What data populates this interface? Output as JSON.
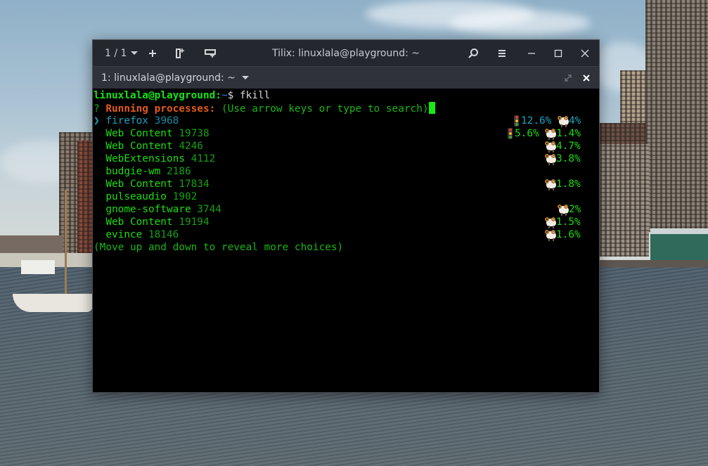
{
  "window": {
    "title": "Tilix: linuxlala@playground: ~",
    "session_counter": "1 / 1",
    "headerbar_icons": [
      "chevron-down-icon",
      "add-icon",
      "split-horizontal-icon",
      "split-vertical-icon",
      "search-icon",
      "hamburger-menu-icon",
      "minimize-icon",
      "maximize-icon",
      "close-icon"
    ]
  },
  "tab": {
    "label": "1: linuxlala@playground: ~",
    "maximize_icon": "expand-icon",
    "close_icon": "close-icon"
  },
  "terminal": {
    "prompt_user_host": "linuxlala@playground",
    "prompt_colon": ":",
    "prompt_path": "~",
    "prompt_symbol": "$ ",
    "command": "fkill",
    "question_mark": "? ",
    "question_label": "Running processes:",
    "question_hint": " (Use arrow keys or type to search)",
    "selection_pointer": "❯",
    "processes": [
      {
        "name": "firefox",
        "pid": "3968",
        "cpu": "12.6%",
        "mem": "4%",
        "selected": true
      },
      {
        "name": "Web Content",
        "pid": "19738",
        "cpu": "5.6%",
        "mem": "1.4%",
        "selected": false
      },
      {
        "name": "Web Content",
        "pid": "4246",
        "cpu": "",
        "mem": "4.7%",
        "selected": false
      },
      {
        "name": "WebExtensions",
        "pid": "4112",
        "cpu": "",
        "mem": "3.8%",
        "selected": false
      },
      {
        "name": "budgie-wm",
        "pid": "2186",
        "cpu": "",
        "mem": "",
        "selected": false
      },
      {
        "name": "Web Content",
        "pid": "17834",
        "cpu": "",
        "mem": "1.8%",
        "selected": false
      },
      {
        "name": "pulseaudio",
        "pid": "1902",
        "cpu": "",
        "mem": "",
        "selected": false
      },
      {
        "name": "gnome-software",
        "pid": "3744",
        "cpu": "",
        "mem": "2%",
        "selected": false
      },
      {
        "name": "Web Content",
        "pid": "19194",
        "cpu": "",
        "mem": "1.5%",
        "selected": false
      },
      {
        "name": "evince",
        "pid": "18146",
        "cpu": "",
        "mem": "1.6%",
        "selected": false
      }
    ],
    "footer_hint": "(Move up and down to reveal more choices)",
    "cpu_icon": "traffic-light-icon",
    "mem_icon": "ram-icon"
  },
  "colors": {
    "headerbar_bg": "#25272e",
    "tabbar_bg": "#30323a",
    "terminal_bg": "#000000",
    "prompt_green": "#14e414",
    "path_blue": "#2a7fff",
    "question_orange": "#e25b1c",
    "selected_cyan": "#1aa3c0",
    "text_green": "#16c60c"
  }
}
